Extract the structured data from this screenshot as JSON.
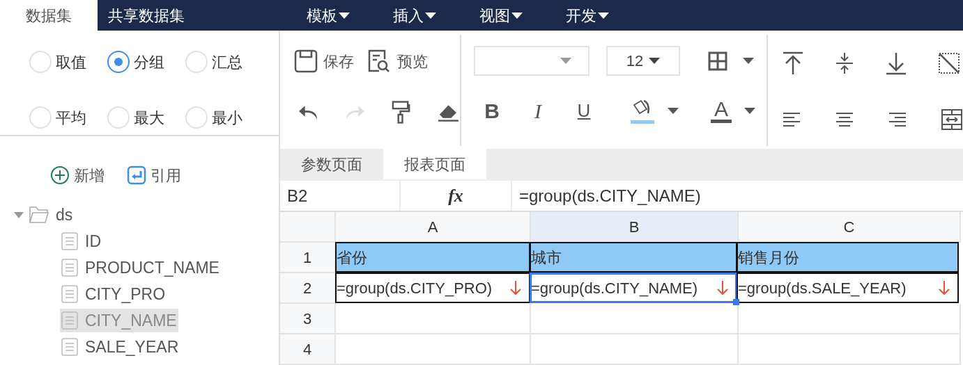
{
  "tabs": [
    {
      "label": "数据集",
      "selected": true
    },
    {
      "label": "共享数据集",
      "selected": false
    }
  ],
  "menus": [
    {
      "label": "模板"
    },
    {
      "label": "插入"
    },
    {
      "label": "视图"
    },
    {
      "label": "开发"
    }
  ],
  "aggregation": [
    {
      "label": "取值",
      "selected": false
    },
    {
      "label": "分组",
      "selected": true
    },
    {
      "label": "汇总",
      "selected": false
    },
    {
      "label": "平均",
      "selected": false
    },
    {
      "label": "最大",
      "selected": false
    },
    {
      "label": "最小",
      "selected": false
    }
  ],
  "actions": [
    {
      "label": "新增",
      "kind": "add"
    },
    {
      "label": "引用",
      "kind": "reference"
    }
  ],
  "tree": {
    "label": "ds",
    "expanded": true,
    "children": [
      {
        "label": "ID",
        "selected": false
      },
      {
        "label": "PRODUCT_NAME",
        "selected": false
      },
      {
        "label": "CITY_PRO",
        "selected": false
      },
      {
        "label": "CITY_NAME",
        "selected": true
      },
      {
        "label": "SALE_YEAR",
        "selected": false
      }
    ]
  },
  "toolbar": {
    "save": "保存",
    "preview": "预览",
    "redo_disabled": true,
    "font_size": "12",
    "format": [
      {
        "label": "B",
        "kind": "bold"
      },
      {
        "label": "I",
        "kind": "italic"
      },
      {
        "label": "U",
        "kind": "underline"
      }
    ],
    "font_color": "A"
  },
  "sheet_tabs": [
    {
      "label": "参数页面",
      "selected": false
    },
    {
      "label": "报表页面",
      "selected": true
    }
  ],
  "formula_bar": {
    "cell": "B2",
    "fx": "fx",
    "formula": "=group(ds.CITY_NAME)"
  },
  "grid": {
    "columns": [
      {
        "label": "A",
        "selected": false
      },
      {
        "label": "B",
        "selected": true
      },
      {
        "label": "C",
        "selected": false
      }
    ],
    "rows": [
      {
        "label": "1",
        "kind": "header",
        "cells": [
          {
            "text": "省份",
            "expand": false,
            "selected": false
          },
          {
            "text": "城市",
            "expand": false,
            "selected": false
          },
          {
            "text": "销售月份",
            "expand": false,
            "selected": false
          }
        ]
      },
      {
        "label": "2",
        "kind": "formula",
        "cells": [
          {
            "text": "=group(ds.CITY_PRO)",
            "expand": true,
            "selected": false
          },
          {
            "text": "=group(ds.CITY_NAME)",
            "expand": true,
            "selected": true
          },
          {
            "text": "=group(ds.SALE_YEAR)",
            "expand": true,
            "selected": false
          }
        ]
      },
      {
        "label": "3",
        "kind": "empty"
      },
      {
        "label": "4",
        "kind": "empty"
      }
    ]
  }
}
